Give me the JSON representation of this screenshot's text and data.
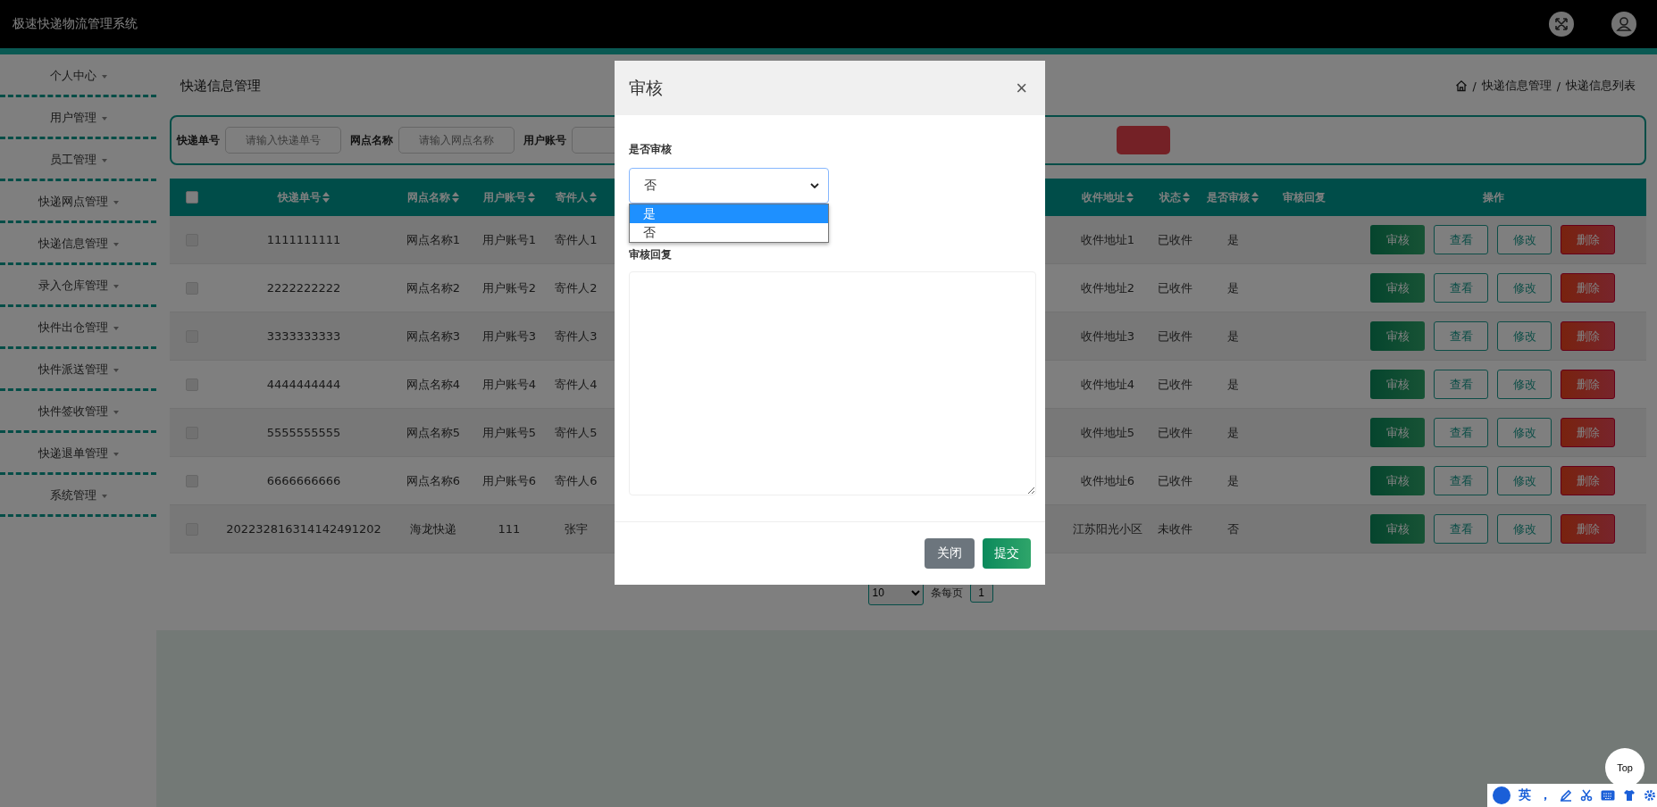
{
  "app_title": "极速快递物流管理系统",
  "sidebar": {
    "items": [
      {
        "label": "个人中心",
        "expanded": false
      },
      {
        "label": "用户管理",
        "expanded": false
      },
      {
        "label": "员工管理",
        "expanded": false
      },
      {
        "label": "快递网点管理",
        "expanded": false
      },
      {
        "label": "快递信息管理",
        "expanded": false
      },
      {
        "label": "录入仓库管理",
        "expanded": false
      },
      {
        "label": "快件出仓管理",
        "expanded": false
      },
      {
        "label": "快件派送管理",
        "expanded": false
      },
      {
        "label": "快件签收管理",
        "expanded": false
      },
      {
        "label": "快递退单管理",
        "expanded": false
      },
      {
        "label": "系统管理",
        "expanded": false
      }
    ]
  },
  "page_title": "快递信息管理",
  "breadcrumb": {
    "separator": "/",
    "items": [
      "快递信息管理",
      "快递信息列表"
    ]
  },
  "search": {
    "fields": [
      {
        "label": "快递单号",
        "placeholder": "请输入快递单号"
      },
      {
        "label": "网点名称",
        "placeholder": "请输入网点名称"
      },
      {
        "label": "用户账号"
      }
    ]
  },
  "table": {
    "columns": [
      {
        "label": "快递单号",
        "sortable": true
      },
      {
        "label": "网点名称",
        "sortable": true
      },
      {
        "label": "用户账号",
        "sortable": true
      },
      {
        "label": "寄件人",
        "sortable": true
      },
      {
        "label": "收件地址",
        "sortable": true
      },
      {
        "label": "状态",
        "sortable": true
      },
      {
        "label": "是否审核",
        "sortable": true
      },
      {
        "label": "审核回复",
        "sortable": false
      },
      {
        "label": "操作",
        "sortable": false
      }
    ],
    "select_all_checked": false,
    "rows": [
      {
        "checked": false,
        "cells": [
          "1111111111",
          "网点名称1",
          "用户账号1",
          "寄件人1",
          "收件地址1",
          "已收件",
          "是",
          ""
        ],
        "actions": [
          "审核",
          "查看",
          "修改",
          "删除"
        ]
      },
      {
        "checked": false,
        "cells": [
          "2222222222",
          "网点名称2",
          "用户账号2",
          "寄件人2",
          "收件地址2",
          "已收件",
          "是",
          ""
        ],
        "actions": [
          "审核",
          "查看",
          "修改",
          "删除"
        ]
      },
      {
        "checked": false,
        "cells": [
          "3333333333",
          "网点名称3",
          "用户账号3",
          "寄件人3",
          "收件地址3",
          "已收件",
          "是",
          ""
        ],
        "actions": [
          "审核",
          "查看",
          "修改",
          "删除"
        ]
      },
      {
        "checked": false,
        "cells": [
          "4444444444",
          "网点名称4",
          "用户账号4",
          "寄件人4",
          "收件地址4",
          "已收件",
          "是",
          ""
        ],
        "actions": [
          "审核",
          "查看",
          "修改",
          "删除"
        ]
      },
      {
        "checked": false,
        "cells": [
          "5555555555",
          "网点名称5",
          "用户账号5",
          "寄件人5",
          "收件地址5",
          "已收件",
          "是",
          ""
        ],
        "actions": [
          "审核",
          "查看",
          "修改",
          "删除"
        ]
      },
      {
        "checked": false,
        "cells": [
          "6666666666",
          "网点名称6",
          "用户账号6",
          "寄件人6",
          "收件地址6",
          "已收件",
          "是",
          ""
        ],
        "actions": [
          "审核",
          "查看",
          "修改",
          "删除"
        ]
      },
      {
        "checked": false,
        "cells": [
          "202232816314142491202",
          "海龙快递",
          "111",
          "张宇",
          "江苏阳光小区",
          "未收件",
          "否",
          ""
        ],
        "actions": [
          "审核",
          "查看",
          "修改",
          "删除"
        ]
      }
    ]
  },
  "pagination": {
    "page_size": "10",
    "page_size_label": "条每页",
    "pages": [
      "1"
    ]
  },
  "dialog": {
    "title": "审核",
    "close": "×",
    "review_label": "是否审核",
    "review_value": "否",
    "review_options": [
      {
        "label": "是",
        "selected": true
      },
      {
        "label": "否",
        "selected": false
      }
    ],
    "reply_label": "审核回复",
    "buttons": [
      {
        "label": "关闭",
        "kind": "secondary"
      },
      {
        "label": "提交",
        "kind": "primary"
      }
    ]
  },
  "top_button": "Top",
  "ime_bar": {
    "mode": "英",
    "punct": "，"
  }
}
